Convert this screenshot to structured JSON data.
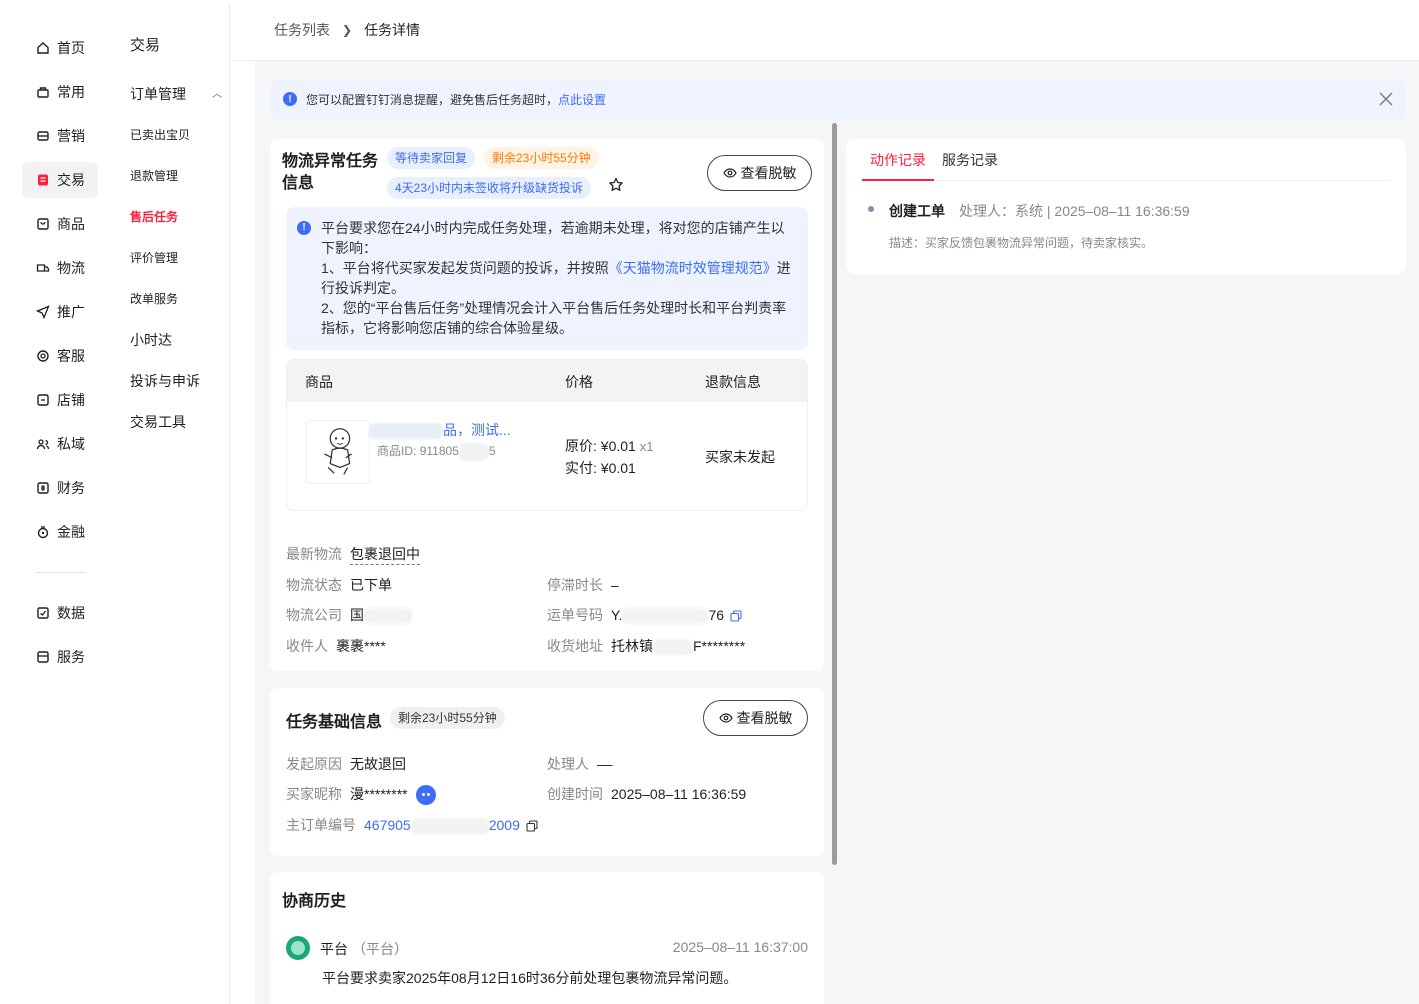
{
  "nav": {
    "items": [
      {
        "label": "首页",
        "icon": "home-icon"
      },
      {
        "label": "常用",
        "icon": "common-icon"
      },
      {
        "label": "营销",
        "icon": "marketing-icon"
      },
      {
        "label": "交易",
        "icon": "trade-icon"
      },
      {
        "label": "商品",
        "icon": "goods-icon"
      },
      {
        "label": "物流",
        "icon": "logistics-icon"
      },
      {
        "label": "推广",
        "icon": "promote-icon"
      },
      {
        "label": "客服",
        "icon": "service-icon"
      },
      {
        "label": "店铺",
        "icon": "shop-icon"
      },
      {
        "label": "私域",
        "icon": "private-icon"
      },
      {
        "label": "财务",
        "icon": "finance-icon"
      },
      {
        "label": "金融",
        "icon": "money-icon"
      }
    ],
    "bottom_items": [
      {
        "label": "数据",
        "icon": "data-icon"
      },
      {
        "label": "服务",
        "icon": "service-box-icon"
      }
    ],
    "active": "交易"
  },
  "subnav": {
    "title": "交易",
    "group": "订单管理",
    "items": [
      "已卖出宝贝",
      "退款管理",
      "售后任务",
      "评价管理",
      "改单服务"
    ],
    "active": "售后任务",
    "extra_items": [
      "小时达",
      "投诉与申诉",
      "交易工具"
    ]
  },
  "breadcrumb": {
    "parent": "任务列表",
    "current": "任务详情"
  },
  "notice": {
    "text": "您可以配置钉钉消息提醒，避免售后任务超时，",
    "link": "点此设置"
  },
  "task": {
    "title": "物流异常任务信息",
    "tag_status": "等待卖家回复",
    "tag_remaining": "剩余23小时55分钟",
    "tag_upgrade": "4天23小时内未签收将升级缺货投诉",
    "view_button": "查看脱敏",
    "warn_line1": "平台要求您在24小时内完成任务处理，若逾期未处理，将对您的店铺产生以下影响：",
    "warn_line2_pre": "1、平台将代买家发起发货问题的投诉，并按照",
    "warn_line2_link": "《天猫物流时效管理规范》",
    "warn_line2_post": "进行投诉判定。",
    "warn_line3": "2、您的“平台售后任务”处理情况会计入平台售后任务处理时长和平台判责率指标，它将影响您店铺的综合体验星级。"
  },
  "goods_table": {
    "headers": [
      "商品",
      "价格",
      "退款信息"
    ],
    "name_suffix": "品，测试...",
    "id_label": "商品ID:",
    "id_prefix": "911805",
    "id_suffix": "5",
    "price_original": "原价: ¥0.01",
    "qty": "x1",
    "price_paid": "实付: ¥0.01",
    "refund": "买家未发起"
  },
  "logistics": {
    "latest_label": "最新物流",
    "latest_value": "包裹退回中",
    "status_label": "物流状态",
    "status_value": "已下单",
    "stay_label": "停滞时长",
    "stay_value": "–",
    "company_label": "物流公司",
    "company_value": "国",
    "waybill_label": "运单号码",
    "waybill_prefix": "Y.",
    "waybill_suffix": "76",
    "receiver_label": "收件人",
    "receiver_value": "裹裹****",
    "address_label": "收货地址",
    "address_prefix": "托林镇",
    "address_suffix": "F********"
  },
  "basic": {
    "title": "任务基础信息",
    "tag_remaining": "剩余23小时55分钟",
    "view_button": "查看脱敏",
    "reason_label": "发起原因",
    "reason_value": "无故退回",
    "handler_label": "处理人",
    "handler_value": "––",
    "buyer_label": "买家昵称",
    "buyer_value": "漫********",
    "created_label": "创建时间",
    "created_value": "2025–08–11 16:36:59",
    "order_label": "主订单编号",
    "order_prefix": "467905",
    "order_suffix": "2009"
  },
  "history": {
    "title": "协商历史",
    "name": "平台",
    "role": "（平台）",
    "time": "2025–08–11 16:37:00",
    "text": "平台要求卖家2025年08月12日16时36分前处理包裹物流异常问题。"
  },
  "records": {
    "tabs": [
      "动作记录",
      "服务记录"
    ],
    "active_tab": "动作记录",
    "title": "创建工单",
    "meta": "处理人：系统 | 2025–08–11 16:36:59",
    "desc": "描述：买家反馈包裹物流异常问题，待卖家核实。"
  },
  "colors": {
    "accent_red": "#ff1f3d",
    "link_blue": "#3d6cf6",
    "notice_bg": "#eef3ff"
  }
}
